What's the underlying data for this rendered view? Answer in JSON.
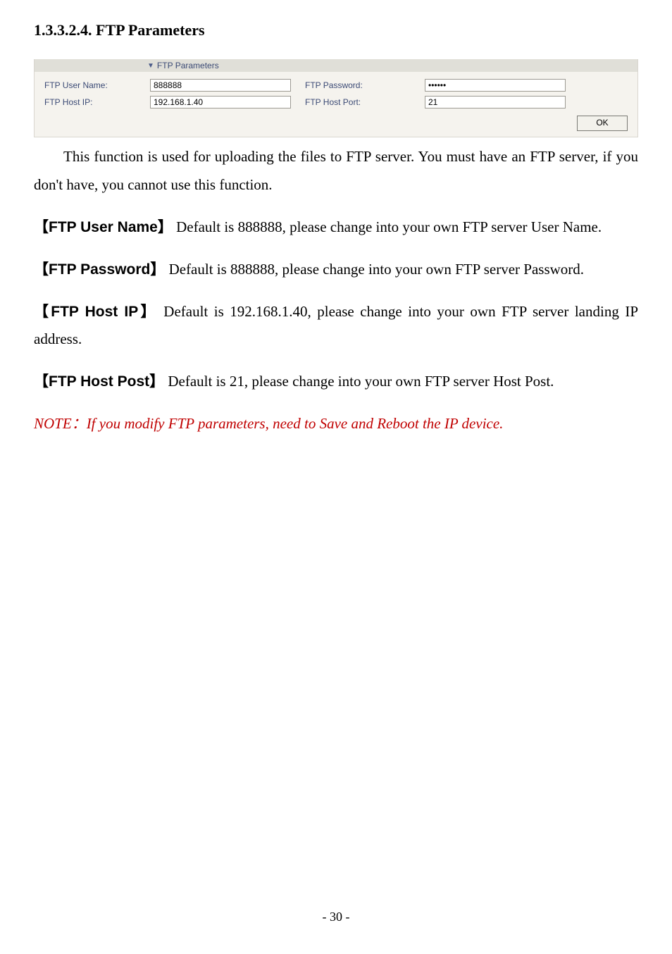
{
  "heading": "1.3.3.2.4. FTP Parameters",
  "ui": {
    "panel_title": "FTP Parameters",
    "labels": {
      "user": "FTP User Name:",
      "pass": "FTP Password:",
      "host": "FTP Host IP:",
      "port": "FTP Host Port:"
    },
    "values": {
      "user": "888888",
      "pass": "••••••",
      "host": "192.168.1.40",
      "port": "21"
    },
    "ok": "OK"
  },
  "body": {
    "intro": "This function is used for uploading the files to FTP server. You must have an FTP server, if you don't have, you cannot use this function.",
    "user_label": "【FTP User Name】",
    "user_text": "Default is 888888, please change into your own FTP server User Name.",
    "pass_label": "【FTP Password】",
    "pass_text": "Default is 888888, please change into your own FTP server Password.",
    "host_label": "【FTP Host IP】",
    "host_text": "Default is 192.168.1.40, please change into your own FTP server landing IP address.",
    "port_label": "【FTP Host Post】",
    "port_text": "Default is 21, please change into your own FTP server Host Post.",
    "note_label": "NOTE：",
    "note_text": "If you modify FTP parameters, need to Save and Reboot the IP device."
  },
  "page_number": "- 30 -"
}
